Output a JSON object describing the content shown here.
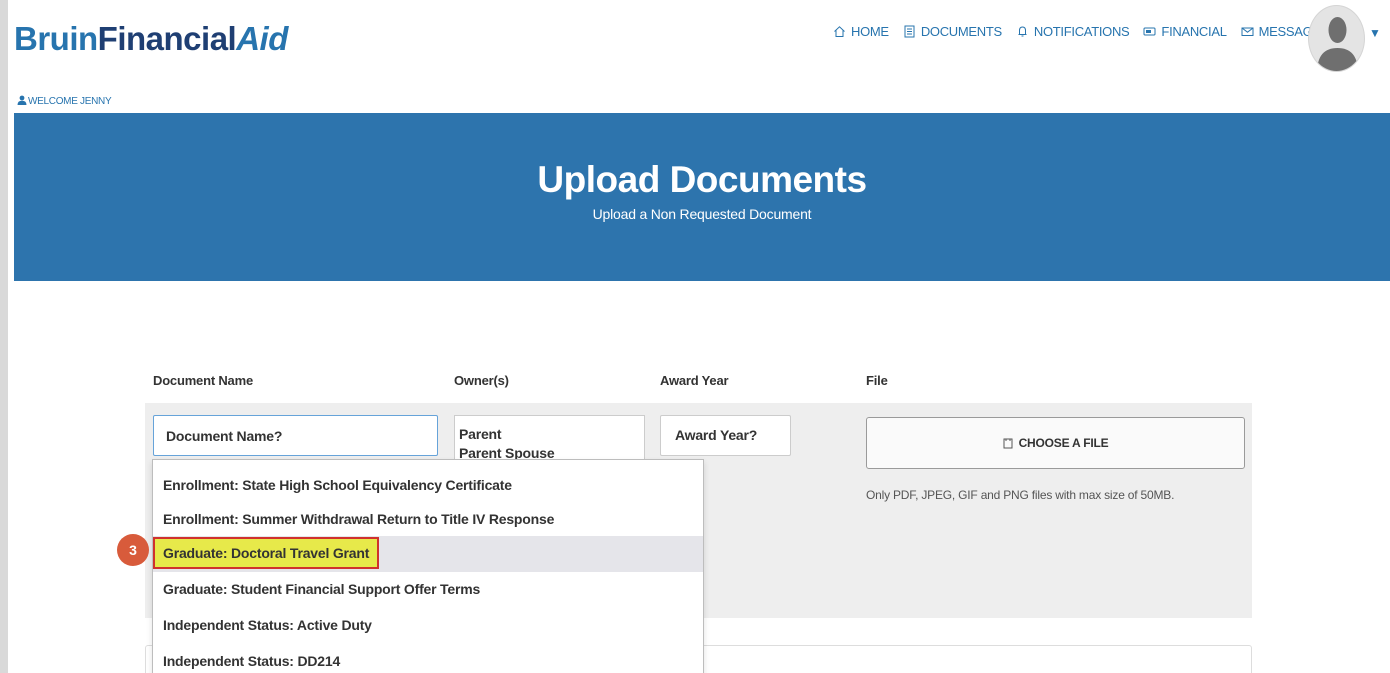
{
  "header": {
    "logo": {
      "part1": "Bruin",
      "part2": "Financial",
      "part3": "Aid"
    },
    "welcome": "WELCOME JENNY",
    "nav": [
      {
        "label": "HOME",
        "icon": "home-icon"
      },
      {
        "label": "DOCUMENTS",
        "icon": "documents-icon"
      },
      {
        "label": "NOTIFICATIONS",
        "icon": "bell-icon"
      },
      {
        "label": "FINANCIAL",
        "icon": "financial-icon"
      },
      {
        "label": "MESSAGES",
        "icon": "envelope-icon"
      }
    ],
    "avatar_caret": "▼"
  },
  "banner": {
    "title": "Upload Documents",
    "subtitle": "Upload a Non Requested Document"
  },
  "form": {
    "columns": {
      "document_name": "Document Name",
      "owners": "Owner(s)",
      "award_year": "Award Year",
      "file": "File"
    },
    "document_name_placeholder": "Document Name?",
    "owner_options": [
      "Parent",
      "Parent Spouse"
    ],
    "award_year_placeholder": "Award Year?",
    "file_button": "CHOOSE A FILE",
    "file_note": "Only PDF, JPEG, GIF and PNG files with max size of 50MB."
  },
  "dropdown": {
    "items": [
      "Enrollment: State High School Equivalency Certificate",
      "Enrollment: Summer Withdrawal Return to Title IV Response",
      "Graduate: Doctoral Travel Grant",
      "Graduate: Student Financial Support Offer Terms",
      "Independent Status: Active Duty",
      "Independent Status: DD214"
    ],
    "highlighted_index": 2
  },
  "step_badge": "3",
  "colors": {
    "brand_blue": "#2774ae",
    "banner_blue": "#2d74ad",
    "highlight_yellow": "#e7e94a",
    "highlight_border": "#d0312d",
    "badge_orange": "#d85b3b"
  }
}
